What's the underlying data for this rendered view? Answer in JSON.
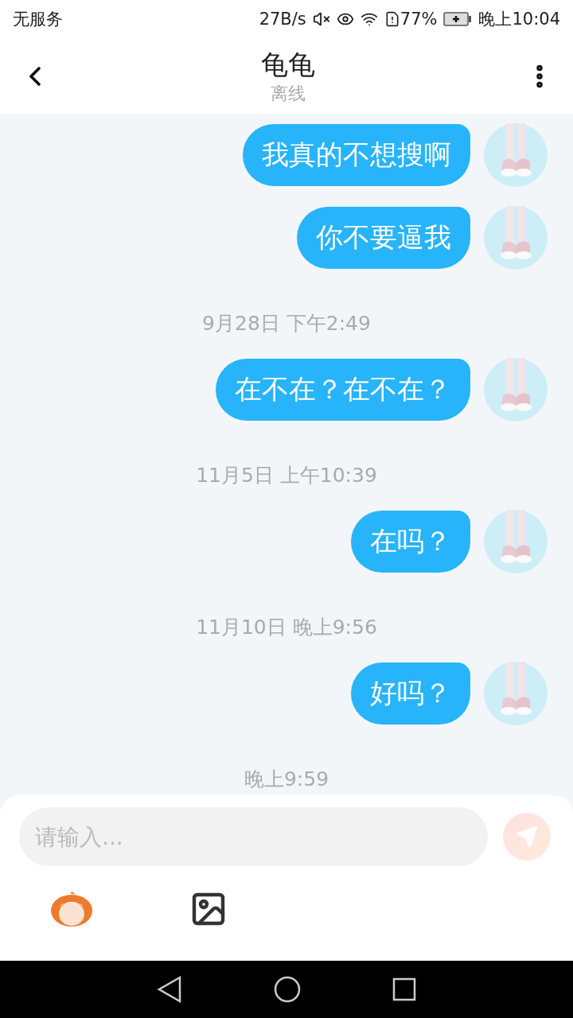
{
  "status_bar": {
    "carrier": "无服务",
    "speed": "27B/s",
    "battery": "77%",
    "time": "晚上10:04"
  },
  "header": {
    "title": "龟龟",
    "subtitle": "离线"
  },
  "messages": [
    {
      "kind": "message",
      "text": "我真的不想搜啊"
    },
    {
      "kind": "message",
      "text": "你不要逼我"
    },
    {
      "kind": "time",
      "text": "9月28日 下午2:49"
    },
    {
      "kind": "message",
      "text": "在不在？在不在？"
    },
    {
      "kind": "time",
      "text": "11月5日 上午10:39"
    },
    {
      "kind": "message",
      "text": "在吗？"
    },
    {
      "kind": "time",
      "text": "11月10日 晚上9:56"
    },
    {
      "kind": "message",
      "text": "好吗？"
    },
    {
      "kind": "time",
      "text": "晚上9:59"
    }
  ],
  "composer": {
    "placeholder": "请输入...",
    "send_disabled": true
  }
}
